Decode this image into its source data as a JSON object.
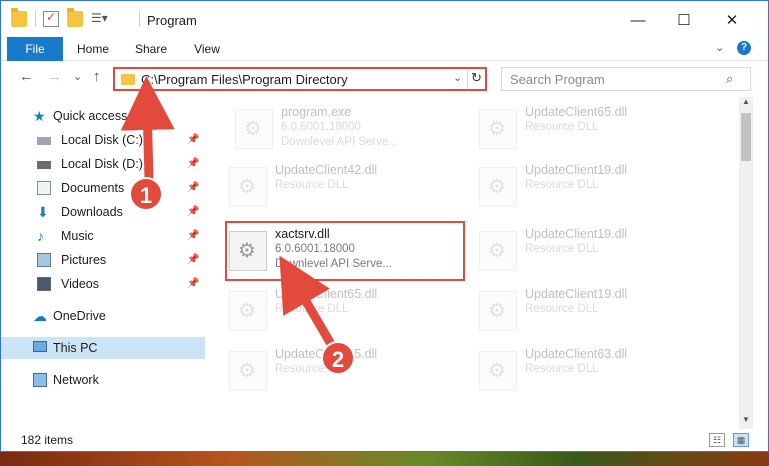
{
  "window": {
    "title": "Program",
    "controls": {
      "minimize": "—",
      "maximize": "☐",
      "close": "✕"
    }
  },
  "ribbon": {
    "tabs": [
      "File",
      "Home",
      "Share",
      "View"
    ],
    "help": "?",
    "collapse": "⌄"
  },
  "nav": {
    "back": "←",
    "forward": "→",
    "recent": "⌄",
    "up": "↑",
    "address": "C:\\Program Files\\Program Directory",
    "address_dropdown": "⌄",
    "refresh": "↻",
    "search_placeholder": "Search Program"
  },
  "sidebar": {
    "items": [
      {
        "label": "Quick access",
        "icon": "star-icon",
        "pinned": false
      },
      {
        "label": "Local Disk (C:)",
        "icon": "drive-icon",
        "pinned": true
      },
      {
        "label": "Local Disk (D:)",
        "icon": "drive-icon",
        "pinned": true
      },
      {
        "label": "Documents",
        "icon": "documents-icon",
        "pinned": true
      },
      {
        "label": "Downloads",
        "icon": "downloads-icon",
        "pinned": true
      },
      {
        "label": "Music",
        "icon": "music-icon",
        "pinned": true
      },
      {
        "label": "Pictures",
        "icon": "pictures-icon",
        "pinned": true
      },
      {
        "label": "Videos",
        "icon": "videos-icon",
        "pinned": true
      },
      {
        "label": "OneDrive",
        "icon": "cloud-icon",
        "pinned": false
      },
      {
        "label": "This PC",
        "icon": "pc-icon",
        "pinned": false,
        "selected": true
      },
      {
        "label": "Network",
        "icon": "network-icon",
        "pinned": false
      }
    ]
  },
  "files": [
    {
      "name": "program.exe",
      "version": "6.0.6001.18000",
      "desc": "Downlevel API Serve...",
      "faded": true
    },
    {
      "name": "UpdateClient65.dll",
      "version": "Resource DLL",
      "desc": "",
      "faded": true
    },
    {
      "name": "UpdateClient42.dll",
      "version": "Resource DLL",
      "desc": "",
      "faded": true
    },
    {
      "name": "UpdateClient19.dll",
      "version": "Resource DLL",
      "desc": "",
      "faded": true
    },
    {
      "name": "xactsrv.dll",
      "version": "6.0.6001.18000",
      "desc": "Downlevel API Serve...",
      "faded": false,
      "highlight": true
    },
    {
      "name": "UpdateClient19.dll",
      "version": "Resource DLL",
      "desc": "",
      "faded": true
    },
    {
      "name": "UpdateClient65.dll",
      "version": "Resource DLL",
      "desc": "",
      "faded": true
    },
    {
      "name": "UpdateClient19.dll",
      "version": "Resource DLL",
      "desc": "",
      "faded": true
    },
    {
      "name": "UpdateClient65.dll",
      "version": "Resource DLL",
      "desc": "",
      "faded": true
    },
    {
      "name": "UpdateClient63.dll",
      "version": "Resource DLL",
      "desc": "",
      "faded": true
    }
  ],
  "status": {
    "items": "182 items"
  },
  "annotations": {
    "step1": "1",
    "step2": "2"
  },
  "colors": {
    "accent": "#1979ca",
    "highlight": "#e24a3b",
    "selected": "#cce4f7"
  }
}
